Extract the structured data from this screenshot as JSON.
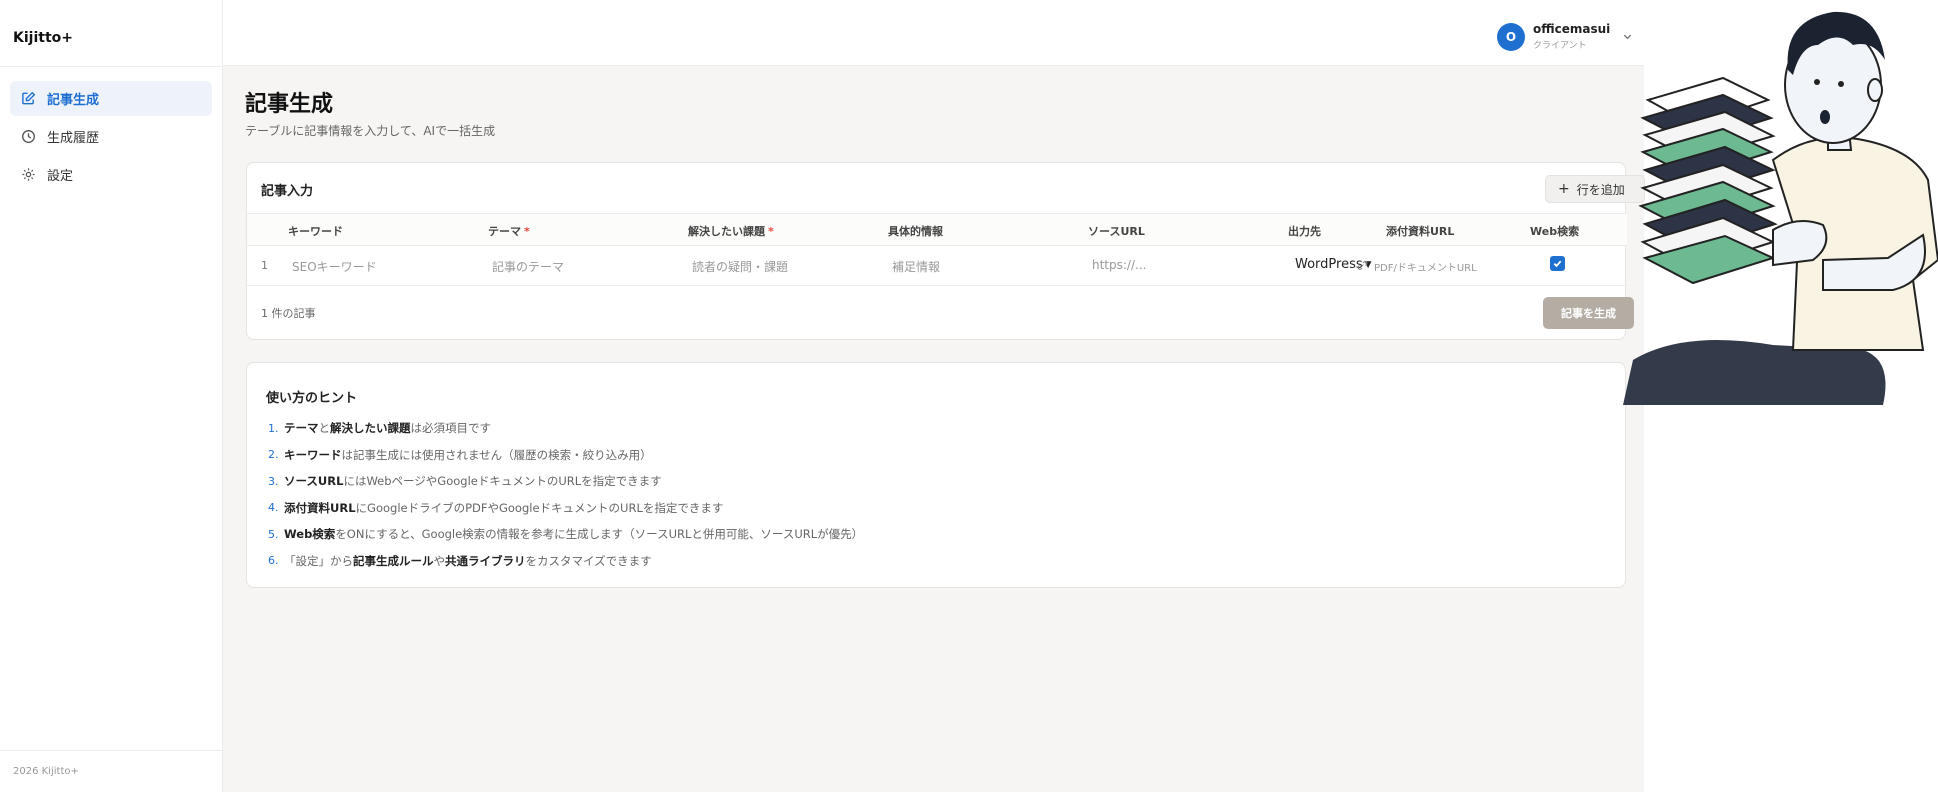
{
  "app": {
    "brand": "Kijitto+",
    "footer": "2026 Kijitto+"
  },
  "sidebar": {
    "items": [
      {
        "label": "記事生成",
        "icon": "edit-icon",
        "active": true
      },
      {
        "label": "生成履歴",
        "icon": "clock-icon",
        "active": false
      },
      {
        "label": "設定",
        "icon": "gear-icon",
        "active": false
      }
    ]
  },
  "user": {
    "initial": "O",
    "name": "officemasui",
    "role": "クライアント"
  },
  "page": {
    "title": "記事生成",
    "subtitle": "テーブルに記事情報を入力して、AIで一括生成"
  },
  "input_card": {
    "title": "記事入力",
    "add_row_label": "行を追加",
    "columns": [
      {
        "label": "キーワード",
        "required": false
      },
      {
        "label": "テーマ",
        "required": true
      },
      {
        "label": "解決したい課題",
        "required": true
      },
      {
        "label": "具体的情報",
        "required": false
      },
      {
        "label": "ソースURL",
        "required": false
      },
      {
        "label": "出力先",
        "required": false
      },
      {
        "label": "添付資料URL",
        "required": false
      },
      {
        "label": "Web検索",
        "required": false
      }
    ],
    "required_mark": "*",
    "row": {
      "number": "1",
      "keyword_placeholder": "SEOキーワード",
      "theme_placeholder": "記事のテーマ",
      "problem_placeholder": "読者の疑問・課題",
      "info_placeholder": "補足情報",
      "source_placeholder": "https://...",
      "output_value": "WordPress",
      "attach_placeholder": "PDF/ドキュメントURL",
      "web_search_checked": true
    },
    "count_label": "1 件の記事",
    "generate_label": "記事を生成"
  },
  "tips": {
    "title": "使い方のヒント",
    "items": [
      {
        "num": "1.",
        "parts": [
          {
            "b": "テーマ"
          },
          {
            "t": "と"
          },
          {
            "b": "解決したい課題"
          },
          {
            "t": "は必須項目です"
          }
        ]
      },
      {
        "num": "2.",
        "parts": [
          {
            "b": "キーワード"
          },
          {
            "t": "は記事生成には使用されません（履歴の検索・絞り込み用）"
          }
        ]
      },
      {
        "num": "3.",
        "parts": [
          {
            "b": "ソースURL"
          },
          {
            "t": "にはWebページやGoogleドキュメントのURLを指定できます"
          }
        ]
      },
      {
        "num": "4.",
        "parts": [
          {
            "b": "添付資料URL"
          },
          {
            "t": "にGoogleドライブのPDFやGoogleドキュメントのURLを指定できます"
          }
        ]
      },
      {
        "num": "5.",
        "parts": [
          {
            "b": "Web検索"
          },
          {
            "t": "をONにすると、Google検索の情報を参考に生成します（ソースURLと併用可能、ソースURLが優先）"
          }
        ]
      },
      {
        "num": "6.",
        "parts": [
          {
            "t": "「設定」から"
          },
          {
            "b": "記事生成ルール"
          },
          {
            "t": "や"
          },
          {
            "b": "共通ライブラリ"
          },
          {
            "t": "をカスタマイズできます"
          }
        ]
      }
    ]
  },
  "colors": {
    "accent": "#1f6fd1",
    "required": "#e04a3b",
    "generate_button": "#b5ada4",
    "page_bg": "#f6f5f3"
  }
}
